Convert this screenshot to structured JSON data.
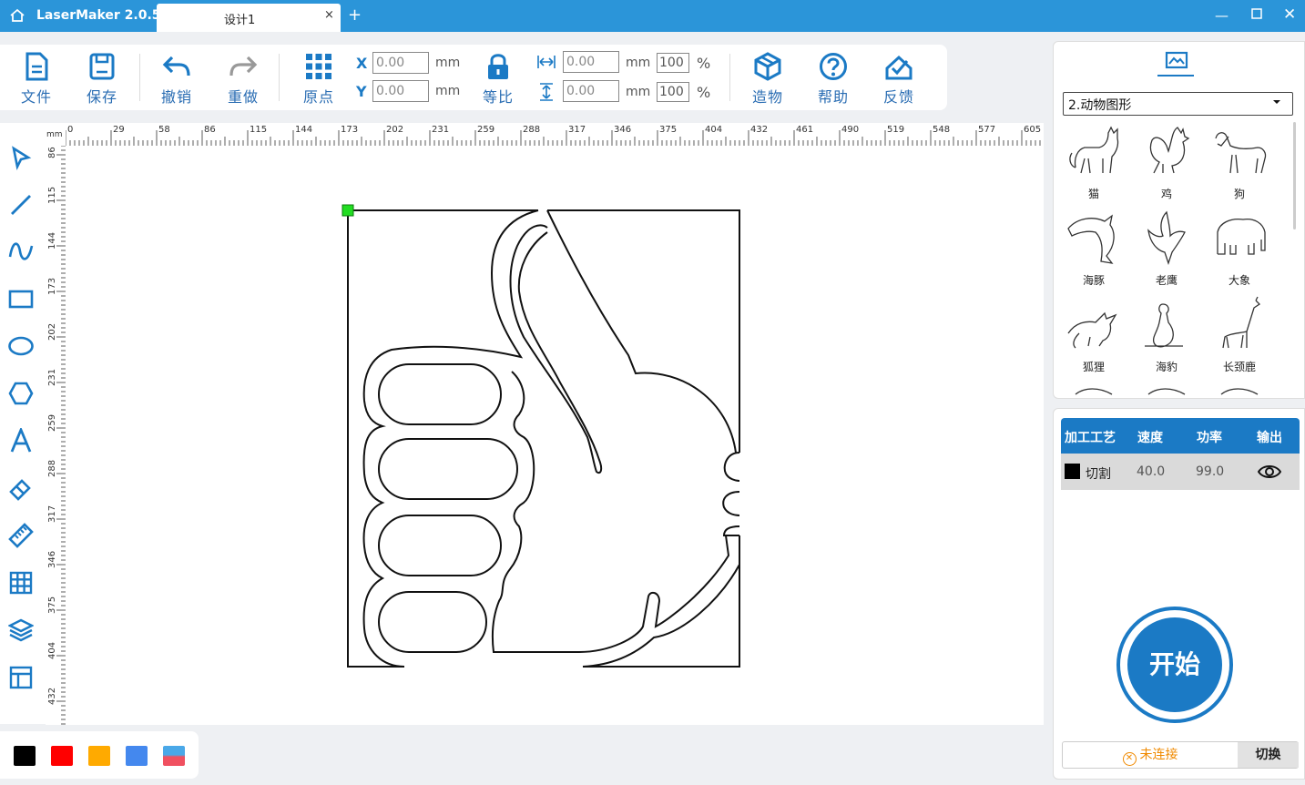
{
  "titlebar": {
    "app_title": "LaserMaker 2.0.5",
    "tab_label": "设计1",
    "tab_close": "×",
    "tab_add": "+",
    "min_glyph": "—",
    "close_glyph": "✕",
    "bg_color": "#2b95d9"
  },
  "toolbar": {
    "file_label": "文件",
    "save_label": "保存",
    "undo_label": "撤销",
    "redo_label": "重做",
    "origin_label": "原点",
    "x_label": "X",
    "y_label": "Y",
    "x_value": "0.00",
    "y_value": "0.00",
    "unit": "mm",
    "lock_label": "等比",
    "width_value": "0.00",
    "height_value": "0.00",
    "width_percent": "100",
    "height_percent": "100",
    "percent_sign": "%",
    "build_label": "造物",
    "help_label": "帮助",
    "feedback_label": "反馈",
    "icon_color": "#1b7ac5"
  },
  "left_tools": [
    "select-arrow-icon",
    "line-icon",
    "curve-icon",
    "rectangle-icon",
    "ellipse-icon",
    "polygon-icon",
    "text-icon",
    "eraser-icon",
    "ruler-icon",
    "grid-array-icon",
    "layers-icon",
    "layout-icon"
  ],
  "ruler": {
    "unit_label": "mm",
    "top_ticks": [
      "0",
      "29",
      "58",
      "86",
      "115",
      "144",
      "173",
      "202",
      "231",
      "259",
      "288",
      "317",
      "346",
      "375",
      "404",
      "432",
      "461",
      "490",
      "519",
      "548",
      "577",
      "605"
    ],
    "left_ticks": [
      "86",
      "115",
      "144",
      "173",
      "202",
      "231",
      "259",
      "288",
      "317",
      "346",
      "375",
      "404",
      "432"
    ]
  },
  "swatches": [
    "#000000",
    "#ff0000",
    "#ffaa00",
    "#4488ee",
    "gradient"
  ],
  "library": {
    "category": "2.动物图形",
    "animals": [
      {
        "name": "猫",
        "icon": "cat-icon"
      },
      {
        "name": "鸡",
        "icon": "rooster-icon"
      },
      {
        "name": "狗",
        "icon": "dog-icon"
      },
      {
        "name": "海豚",
        "icon": "dolphin-icon"
      },
      {
        "name": "老鹰",
        "icon": "eagle-icon"
      },
      {
        "name": "大象",
        "icon": "elephant-icon"
      },
      {
        "name": "狐狸",
        "icon": "fox-icon"
      },
      {
        "name": "海豹",
        "icon": "seal-icon"
      },
      {
        "name": "长颈鹿",
        "icon": "giraffe-icon"
      }
    ]
  },
  "process": {
    "headers": [
      "加工工艺",
      "速度",
      "功率",
      "输出"
    ],
    "rows": [
      {
        "color": "#000000",
        "mode": "切割",
        "speed": "40.0",
        "power": "99.0",
        "output": "eye-icon"
      }
    ],
    "start_label": "开始",
    "connection_status": "未连接",
    "switch_label": "切换"
  }
}
